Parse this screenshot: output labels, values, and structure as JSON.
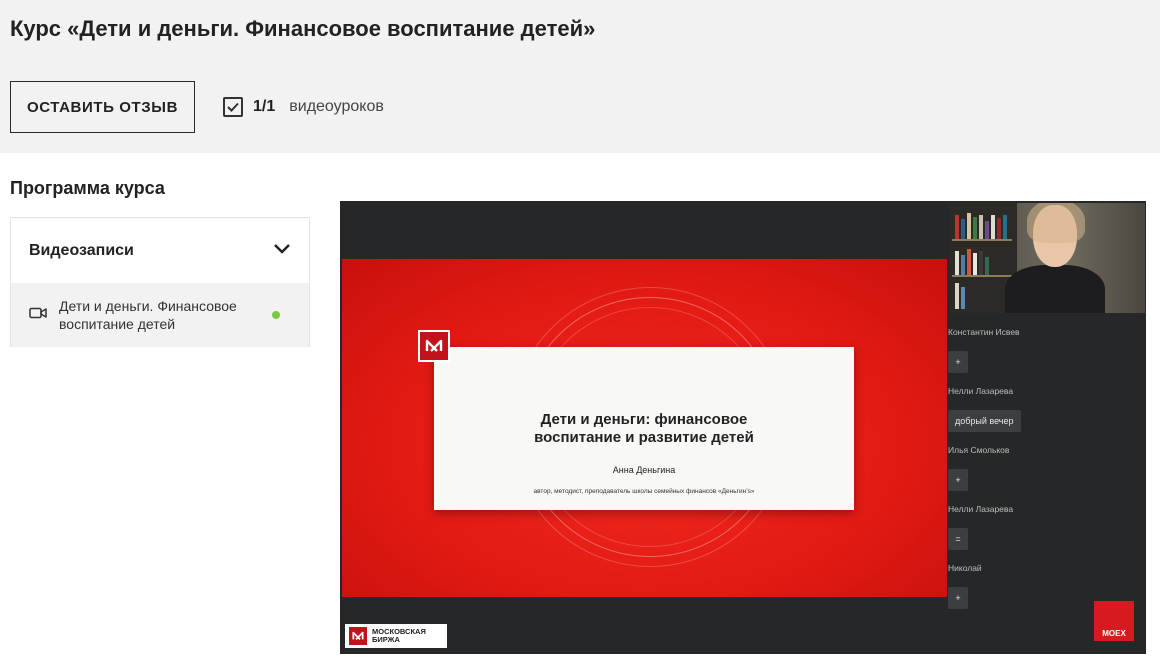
{
  "header": {
    "course_title": "Курс «Дети и деньги. Финансовое воспитание детей»",
    "review_button_label": "ОСТАВИТЬ ОТЗЫВ",
    "progress_count": "1/1",
    "progress_unit": "видеоуроков"
  },
  "program": {
    "title": "Программа курса",
    "section": {
      "label": "Видеозаписи",
      "expanded": true,
      "items": [
        {
          "label": "Дети и деньги. Финансовое воспитание детей",
          "status": "watched",
          "status_color": "#7ac943",
          "icon": "video-camera-icon"
        }
      ]
    }
  },
  "video": {
    "slide": {
      "heading_line1": "Дети и деньги: финансовое",
      "heading_line2": "воспитание и развитие детей",
      "author": "Анна Деньгина",
      "role": "автор, методист, преподаватель школы семейных финансов «Деньгин’s»"
    },
    "chat": [
      {
        "name": "Константин Исвев",
        "message": "+"
      },
      {
        "name": "Нелли Лазарева",
        "message": "добрый вечер"
      },
      {
        "name": "Илья Смольков",
        "message": "+"
      },
      {
        "name": "Нелли Лазарева",
        "message": "="
      },
      {
        "name": "Николай",
        "message": "+"
      }
    ],
    "corner_logo": "MOEX",
    "bottom_logo_line1": "МОСКОВСКАЯ",
    "bottom_logo_line2": "БИРЖА"
  },
  "colors": {
    "accent_red": "#e41b14",
    "status_green": "#7ac943"
  }
}
